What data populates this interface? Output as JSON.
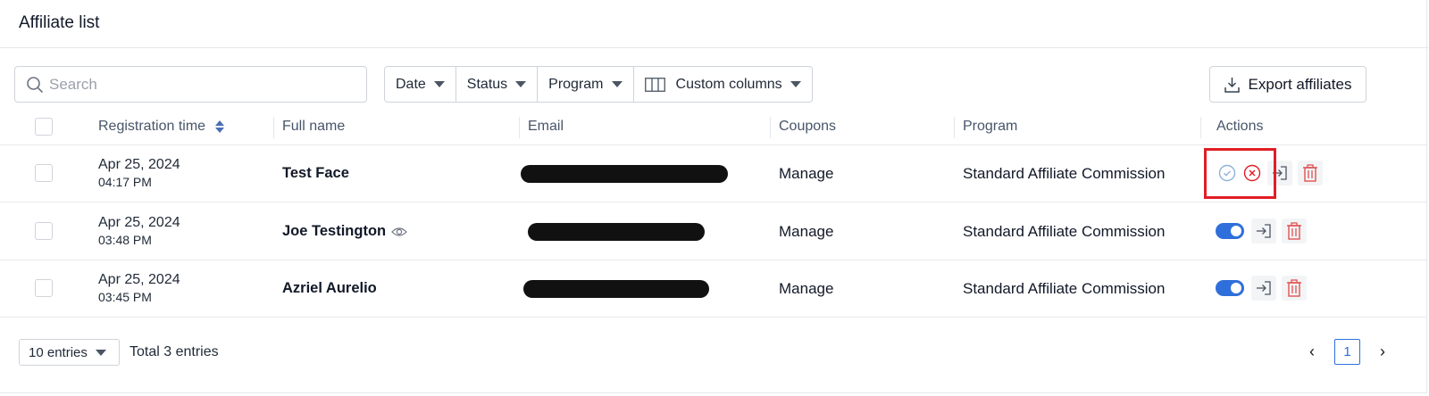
{
  "header": {
    "title": "Affiliate list"
  },
  "toolbar": {
    "search_placeholder": "Search",
    "filters": [
      {
        "label": "Date"
      },
      {
        "label": "Status"
      },
      {
        "label": "Program"
      },
      {
        "label": "Custom columns"
      }
    ],
    "export_label": "Export affiliates"
  },
  "table": {
    "columns": {
      "registration_time": "Registration time",
      "full_name": "Full name",
      "email": "Email",
      "coupons": "Coupons",
      "program": "Program",
      "actions": "Actions"
    },
    "rows": [
      {
        "date": "Apr 25, 2024",
        "time": "04:17 PM",
        "name": "Test Face",
        "coupons": "Manage",
        "program": "Standard Affiliate Commission",
        "status": "pending"
      },
      {
        "date": "Apr 25, 2024",
        "time": "03:48 PM",
        "name": "Joe Testington",
        "coupons": "Manage",
        "program": "Standard Affiliate Commission",
        "status": "active"
      },
      {
        "date": "Apr 25, 2024",
        "time": "03:45 PM",
        "name": "Azriel Aurelio",
        "coupons": "Manage",
        "program": "Standard Affiliate Commission",
        "status": "active"
      }
    ]
  },
  "footer": {
    "entries_label": "10 entries",
    "total_label": "Total 3 entries",
    "current_page": "1",
    "prev_icon": "‹",
    "next_icon": "›"
  },
  "colors": {
    "accent": "#2f6fdb",
    "danger": "#e11d26",
    "delete": "#e05252"
  }
}
